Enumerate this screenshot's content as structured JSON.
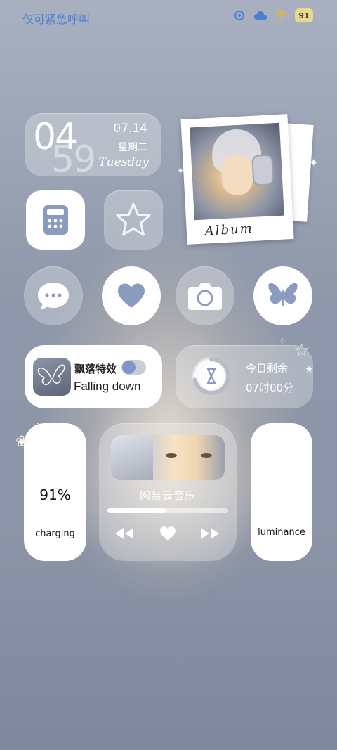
{
  "statusbar": {
    "carrier": "仅可紧急呼叫",
    "battery_level": "91"
  },
  "clock": {
    "hour": "04",
    "minute": "59",
    "date": "07.14",
    "weekday_cn": "星期二",
    "weekday_en": "Tuesday"
  },
  "photo": {
    "label": "Album"
  },
  "falling": {
    "title": "飘落特效",
    "subtitle": "Falling down",
    "toggle_on": false
  },
  "remaining": {
    "title": "今日剩余",
    "time": "07时00分",
    "progress": 0.29
  },
  "battery": {
    "percent": "91%",
    "status": "charging"
  },
  "music": {
    "app_name": "网易云音乐",
    "progress": 0.48
  },
  "luminance": {
    "label": "luminance"
  },
  "icons": {
    "calculator": "calculator-icon",
    "star": "star-icon",
    "message": "message-icon",
    "heart": "heart-icon",
    "camera": "camera-icon",
    "butterfly": "butterfly-icon"
  },
  "colors": {
    "icon_blue": "#8a9bbf",
    "status_blue": "#4a7fd6"
  }
}
